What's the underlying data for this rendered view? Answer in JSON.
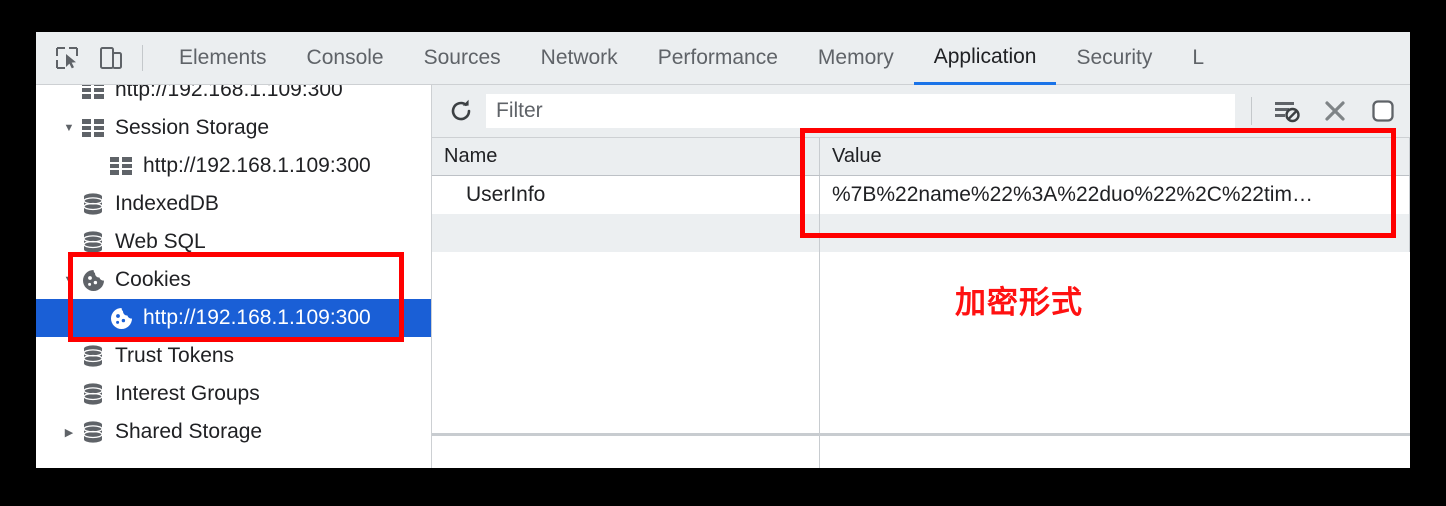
{
  "window": {
    "title": "Chrome DevTools — Application panel (Cookies)"
  },
  "tabbar": {
    "inspect_icon": "inspect-element-icon",
    "device_icon": "device-toolbar-icon",
    "tabs": [
      {
        "label": "Elements",
        "active": false
      },
      {
        "label": "Console",
        "active": false
      },
      {
        "label": "Sources",
        "active": false
      },
      {
        "label": "Network",
        "active": false
      },
      {
        "label": "Performance",
        "active": false
      },
      {
        "label": "Memory",
        "active": false
      },
      {
        "label": "Application",
        "active": true
      },
      {
        "label": "Security",
        "active": false
      },
      {
        "label": "L",
        "active": false
      }
    ]
  },
  "sidebar": {
    "clipped_top_label": "http://192.168.1.109:300",
    "items": [
      {
        "label": "Session Storage",
        "icon": "table-icon",
        "twisty": "down",
        "indent": 0,
        "selected": false
      },
      {
        "label": "http://192.168.1.109:300",
        "icon": "table-icon",
        "twisty": "none",
        "indent": 1,
        "selected": false
      },
      {
        "label": "IndexedDB",
        "icon": "database-icon",
        "twisty": "none",
        "indent": 0,
        "selected": false
      },
      {
        "label": "Web SQL",
        "icon": "database-icon",
        "twisty": "none",
        "indent": 0,
        "selected": false
      },
      {
        "label": "Cookies",
        "icon": "cookie-icon",
        "twisty": "down",
        "indent": 0,
        "selected": false
      },
      {
        "label": "http://192.168.1.109:300",
        "icon": "cookie-icon",
        "twisty": "none",
        "indent": 1,
        "selected": true
      },
      {
        "label": "Trust Tokens",
        "icon": "database-icon",
        "twisty": "none",
        "indent": 0,
        "selected": false
      },
      {
        "label": "Interest Groups",
        "icon": "database-icon",
        "twisty": "none",
        "indent": 0,
        "selected": false
      },
      {
        "label": "Shared Storage",
        "icon": "database-icon",
        "twisty": "right",
        "indent": 0,
        "selected": false
      }
    ],
    "selection_color": "#1a5fd6"
  },
  "toolbar": {
    "refresh_icon": "refresh-icon",
    "filter_placeholder": "Filter",
    "filter_value": "",
    "clear_filtered_icon": "clear-filtered-cookies-icon",
    "clear_all_icon": "clear-all-cookies-icon",
    "issues_checkbox_icon": "checkbox-unchecked-icon"
  },
  "grid": {
    "columns": [
      "Name",
      "Value"
    ],
    "rows": [
      {
        "name": "UserInfo",
        "value": "%7B%22name%22%3A%22duo%22%2C%22tim…"
      }
    ]
  },
  "annotations": {
    "red_color": "#ff0000",
    "note_text": "加密形式",
    "boxes": [
      {
        "name": "cookies-tree-highlight"
      },
      {
        "name": "value-column-highlight"
      }
    ]
  }
}
